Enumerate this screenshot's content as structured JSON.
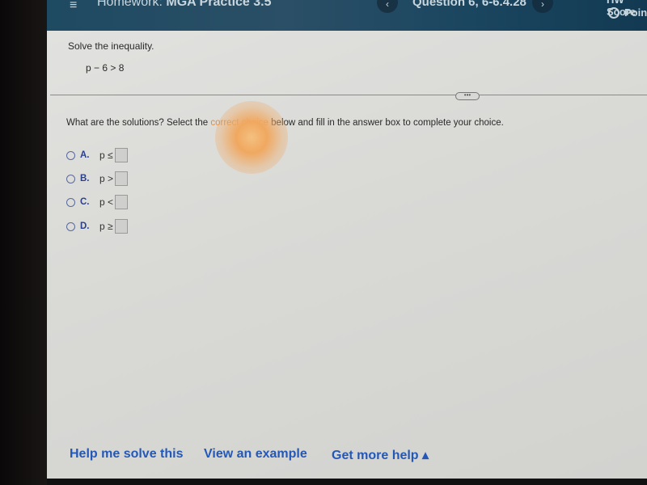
{
  "header": {
    "menu_icon": "≡",
    "title_prefix": "Homework:",
    "title_name": "MGA Practice 3.5",
    "prev_icon": "‹",
    "next_icon": "›",
    "question_label": "Question 6, 6-6.4.28",
    "score_label": "HW Score",
    "points_label": "Points"
  },
  "problem": {
    "prompt": "Solve the inequality.",
    "equation": "p − 6 > 8",
    "more_label": "•••"
  },
  "question": {
    "before": "What are the solutions? Select the ",
    "highlight": "correct choice",
    "after": " below and fill in the answer box to complete your choice."
  },
  "choices": [
    {
      "letter": "A.",
      "expr": "p ≤",
      "value": ""
    },
    {
      "letter": "B.",
      "expr": "p >",
      "value": ""
    },
    {
      "letter": "C.",
      "expr": "p <",
      "value": ""
    },
    {
      "letter": "D.",
      "expr": "p ≥",
      "value": ""
    }
  ],
  "footer": {
    "help_solve": "Help me solve this",
    "view_example": "View an example",
    "more_help": "Get more help ▴"
  }
}
